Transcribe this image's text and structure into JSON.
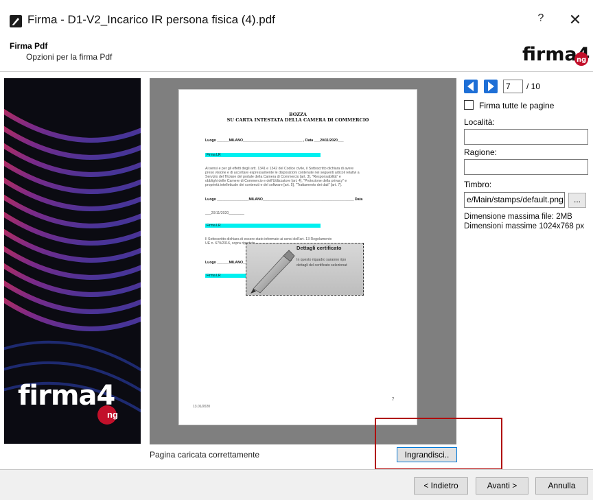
{
  "window": {
    "title": "Firma - D1-V2_Incarico IR persona fisica (4).pdf",
    "help_label": "?",
    "close_label": "✕",
    "app_icon": "pen-icon"
  },
  "header": {
    "title": "Firma Pdf",
    "subtitle": "Opzioni per la firma Pdf",
    "brand": "firma4ng"
  },
  "sidebar": {
    "brand_main": "firma4",
    "brand_sub": "ng"
  },
  "document": {
    "heading_1": "BOZZA",
    "heading_2": "SU CARTA INTESTATA DELLA CAMERA DI COMMERCIO",
    "luogo_line": "Luogo ______MILANO______________________________ , Data ___20/11/2020___",
    "firma_1": "Firma LR",
    "para_1": "Ai sensi e per gli effetti degli artt. 1341 e 1342 del Codice civile, il Sottoscritto dichiara di avere",
    "para_2": "preso visione e di accettare espressamente le disposizioni contenute nei seguenti articoli relativi a",
    "para_3": "Servizio del Titolare del portale della Camera di Commercio [art. 3], \"Responsabilità\" e",
    "para_4": "obblighi delle Camere di Commercio e dell'Utilizzatore [art. 4], \"Protezione della privacy\" e",
    "para_5": "proprietà intellettuale dei contenuti e del software [art. 5], \"Trattamento dei dati\" [art. 7].",
    "luogo_line_2": "Luogo ________________MILANO______________________________________________ Data",
    "data_line": "___20/11/2020________",
    "firma_2": "Firma LR",
    "para_6": "Il Sottoscritto dichiara di essere stato informato ai sensi dell'art. 13 Regolamento",
    "para_7": "UE n. 679/2016, sopra riportato.",
    "luogo_line_3": "Luogo ______MILANO__________________________ , Data ___20/11/2020________",
    "firma_3": "Firma LR",
    "page_number": "7",
    "footer": "13.01/2020"
  },
  "signature_box": {
    "title": "Dettagli certificato",
    "line_1": "In questo riquadro saranno ripo",
    "line_2": "dettagli del certificato selezionat"
  },
  "status": {
    "message": "Pagina caricata correttamente",
    "zoom_label": "Ingrandisci.."
  },
  "navigation": {
    "prev_icon": "arrow-left-icon",
    "next_icon": "arrow-right-icon",
    "current_page": "7",
    "total_pages": "/ 10"
  },
  "options": {
    "sign_all_pages_label": "Firma tutte le pagine",
    "sign_all_pages_checked": false,
    "location_label": "Località:",
    "location_value": "",
    "reason_label": "Ragione:",
    "reason_value": "",
    "stamp_label": "Timbro:",
    "stamp_value": "e/Main/stamps/default.png",
    "browse_label": "...",
    "max_file_size": "Dimensione massima file: 2MB",
    "max_dimensions": "Dimensioni massime 1024x768 px"
  },
  "footer": {
    "back_label": "< Indietro",
    "next_label": "Avanti >",
    "cancel_label": "Annulla"
  },
  "colors": {
    "highlight": "#00f0f0",
    "nav_blue": "#1e6fd6",
    "callout_red": "#b00000",
    "brand_red": "#c2102a"
  }
}
